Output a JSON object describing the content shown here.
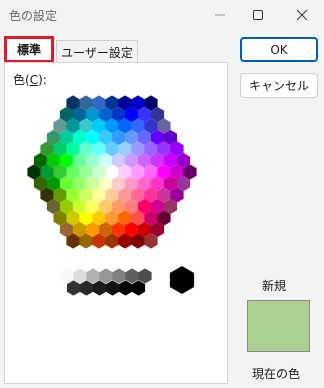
{
  "window": {
    "title": "色の設定"
  },
  "title_buttons": {
    "minimize": "minimize-icon",
    "maximize": "maximize-icon",
    "close": "close-icon"
  },
  "tabs": [
    {
      "label": "標準"
    },
    {
      "label": "ユーザー設定"
    }
  ],
  "color_label": {
    "prefix": "色(",
    "accel": "C",
    "suffix": "):"
  },
  "buttons": {
    "ok": "OK",
    "cancel": "キャンセル"
  },
  "preview": {
    "new_label": "新規",
    "current_label": "現在の色",
    "selected_color": "#aacf8e"
  },
  "palette": {
    "rows": [
      [
        "#003366",
        "#336699",
        "#3366cc",
        "#003399",
        "#000099",
        "#0000cc",
        "#000066"
      ],
      [
        "#006666",
        "#006699",
        "#0099cc",
        "#0066cc",
        "#0033cc",
        "#0000ff",
        "#3333ff",
        "#333399"
      ],
      [
        "#669999",
        "#009999",
        "#33cccc",
        "#00ccff",
        "#0099ff",
        "#0066ff",
        "#3366ff",
        "#3333cc",
        "#666699"
      ],
      [
        "#339966",
        "#00cc99",
        "#00ffcc",
        "#00ffff",
        "#33ccff",
        "#3399ff",
        "#6699ff",
        "#6666ff",
        "#6600ff",
        "#6600cc"
      ],
      [
        "#339933",
        "#00cc66",
        "#00ff99",
        "#66ffcc",
        "#66ffff",
        "#66ccff",
        "#99ccff",
        "#9999ff",
        "#9966ff",
        "#9933ff",
        "#9900ff"
      ],
      [
        "#006600",
        "#00cc00",
        "#00ff00",
        "#66ff99",
        "#99ffcc",
        "#ccffff",
        "#ccccff",
        "#cc99ff",
        "#cc66ff",
        "#cc33ff",
        "#cc00ff",
        "#9900cc"
      ],
      [
        "#003300",
        "#009933",
        "#33cc33",
        "#66ff66",
        "#99ff99",
        "#ccffcc",
        "#ffffff",
        "#ffccff",
        "#ff99ff",
        "#ff66ff",
        "#ff00ff",
        "#cc00cc",
        "#660066"
      ],
      [
        "#336600",
        "#009900",
        "#66ff33",
        "#99ff66",
        "#ccff99",
        "#ffffcc",
        "#ffcccc",
        "#ff99cc",
        "#ff66cc",
        "#ff33cc",
        "#cc0099",
        "#993399"
      ],
      [
        "#333300",
        "#669900",
        "#99ff33",
        "#ccff66",
        "#ffff99",
        "#ffcc99",
        "#ff9999",
        "#ff6699",
        "#ff3399",
        "#cc3399",
        "#990099"
      ],
      [
        "#666633",
        "#99cc00",
        "#ccff33",
        "#ffff66",
        "#ffcc66",
        "#ff9966",
        "#ff7c80",
        "#ff0066",
        "#d60093",
        "#993366"
      ],
      [
        "#808000",
        "#cccc00",
        "#ffff00",
        "#ffcc00",
        "#ff9933",
        "#ff6600",
        "#ff5050",
        "#cc0066",
        "#660033"
      ],
      [
        "#996633",
        "#cc9900",
        "#ff9900",
        "#cc6600",
        "#ff3300",
        "#ff0000",
        "#cc0000",
        "#990033"
      ],
      [
        "#663300",
        "#996600",
        "#cc3300",
        "#993300",
        "#990000",
        "#800000",
        "#993333"
      ]
    ],
    "grays": [
      "#f8f8f8",
      "#dddddd",
      "#b2b2b2",
      "#969696",
      "#808080",
      "#5f5f5f",
      "#4d4d4d",
      "#333333",
      "#292929",
      "#1c1c1c",
      "#111111",
      "#080808",
      "#000000"
    ],
    "big_white": "#ffffff",
    "big_black": "#000000"
  }
}
